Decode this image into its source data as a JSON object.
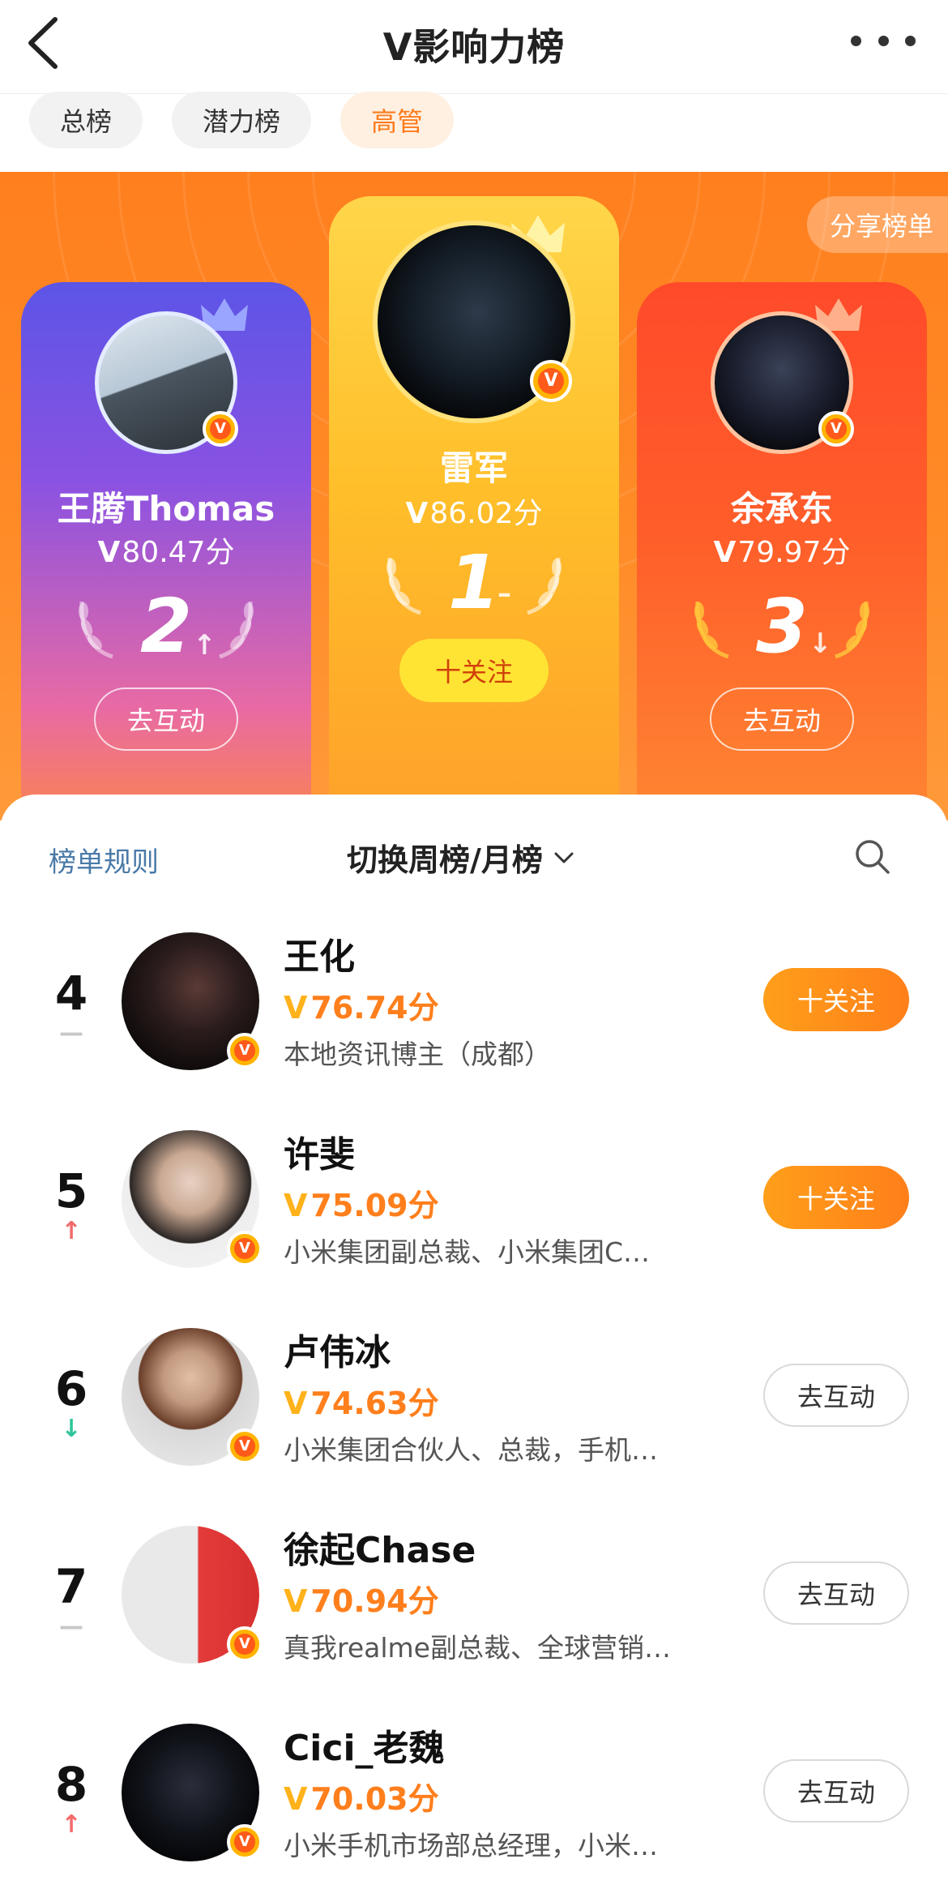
{
  "header": {
    "title": "V影响力榜"
  },
  "tabs": [
    {
      "label": "总榜",
      "active": false
    },
    {
      "label": "潜力榜",
      "active": false
    },
    {
      "label": "高管",
      "active": true
    }
  ],
  "hero": {
    "share_label": "分享榜单",
    "top3": [
      {
        "rank": "2",
        "name": "王腾Thomas",
        "v_mark": "V",
        "score": "80.47分",
        "trend": "up",
        "trend_glyph": "↑",
        "action": "去互动"
      },
      {
        "rank": "1",
        "name": "雷军",
        "v_mark": "V",
        "score": "86.02分",
        "trend": "same",
        "trend_glyph": "–",
        "action": "十关注"
      },
      {
        "rank": "3",
        "name": "余承东",
        "v_mark": "V",
        "score": "79.97分",
        "trend": "down",
        "trend_glyph": "↓",
        "action": "去互动"
      }
    ]
  },
  "list_header": {
    "rules_label": "榜单规则",
    "switch_label": "切换周榜/月榜"
  },
  "list": [
    {
      "rank": "4",
      "trend": "same",
      "trend_glyph": "—",
      "name": "王化",
      "v_mark": "V",
      "score": "76.74分",
      "desc": "本地资讯博主（成都）",
      "action": "十关注",
      "action_type": "follow"
    },
    {
      "rank": "5",
      "trend": "up",
      "trend_glyph": "↑",
      "name": "许斐",
      "v_mark": "V",
      "score": "75.09分",
      "desc": "小米集团副总裁、小米集团C…",
      "action": "十关注",
      "action_type": "follow"
    },
    {
      "rank": "6",
      "trend": "down",
      "trend_glyph": "↓",
      "name": "卢伟冰",
      "v_mark": "V",
      "score": "74.63分",
      "desc": "小米集团合伙人、总裁，手机…",
      "action": "去互动",
      "action_type": "interact"
    },
    {
      "rank": "7",
      "trend": "same",
      "trend_glyph": "—",
      "name": "徐起Chase",
      "v_mark": "V",
      "score": "70.94分",
      "desc": "真我realme副总裁、全球营销…",
      "action": "去互动",
      "action_type": "interact"
    },
    {
      "rank": "8",
      "trend": "up",
      "trend_glyph": "↑",
      "name": "Cici_老魏",
      "v_mark": "V",
      "score": "70.03分",
      "desc": "小米手机市场部总经理，小米…",
      "action": "去互动",
      "action_type": "interact"
    }
  ],
  "colors": {
    "accent_orange": "#ff7f1c",
    "trend_up": "#f26b6b",
    "trend_down": "#2fc59a",
    "trend_same": "#c8c8c8"
  },
  "icons": {
    "back": "chevron-left-icon",
    "more": "more-dots-icon",
    "search": "search-icon",
    "switch": "chevron-down-icon",
    "badge": "verified-v-icon",
    "crown": "crown-icon",
    "laurel": "laurel-icon"
  }
}
